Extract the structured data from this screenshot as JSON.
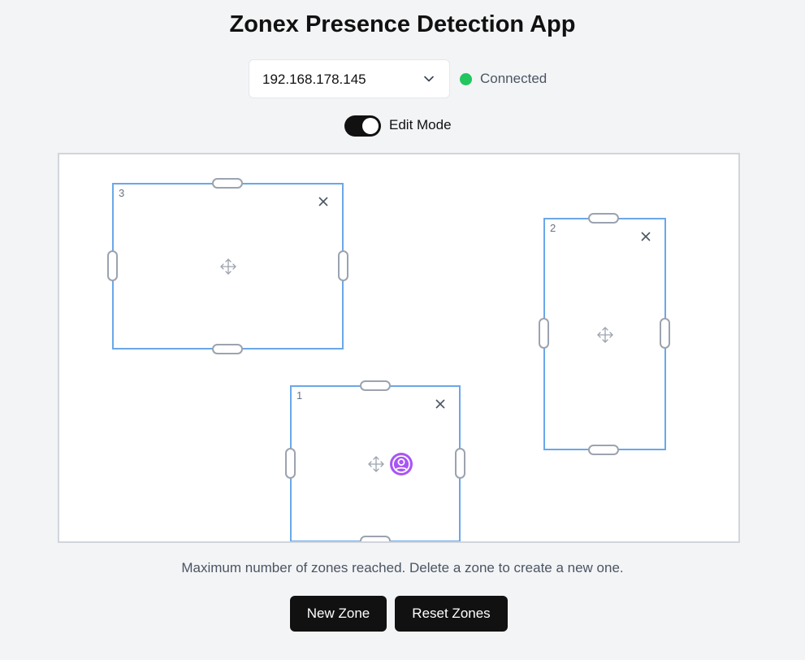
{
  "header": {
    "title": "Zonex Presence Detection App"
  },
  "device": {
    "selected_ip": "192.168.178.145",
    "status": "Connected",
    "status_color": "#22c55e"
  },
  "edit_mode": {
    "label": "Edit Mode",
    "enabled": true
  },
  "zones": [
    {
      "number": "3"
    },
    {
      "number": "2"
    },
    {
      "number": "1"
    }
  ],
  "message": "Maximum number of zones reached. Delete a zone to create a new one.",
  "buttons": {
    "new_zone": "New Zone",
    "reset_zones": "Reset Zones"
  },
  "colors": {
    "accent": "#111111",
    "zone_border": "#6aa8e8",
    "person": "#a855f7"
  }
}
